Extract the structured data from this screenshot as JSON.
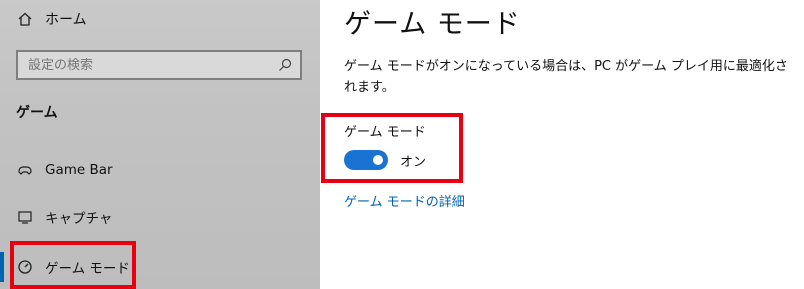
{
  "sidebar": {
    "home": {
      "label": "ホーム",
      "icon": "home-icon"
    },
    "search": {
      "placeholder": "設定の検索",
      "icon": "search-icon"
    },
    "section_title": "ゲーム",
    "items": [
      {
        "label": "Game Bar",
        "icon": "game-bar-icon",
        "selected": false
      },
      {
        "label": "キャプチャ",
        "icon": "capture-icon",
        "selected": false
      },
      {
        "label": "ゲーム モード",
        "icon": "game-mode-icon",
        "selected": true
      }
    ]
  },
  "main": {
    "title": "ゲーム モード",
    "description": "ゲーム モードがオンになっている場合は、PC がゲーム プレイ用に最適化されます。",
    "toggle": {
      "label": "ゲーム モード",
      "state_label": "オン",
      "on": true
    },
    "link": "ゲーム モードの詳細"
  },
  "colors": {
    "accent": "#0063b1",
    "toggle_on": "#1a73d2",
    "highlight_box": "#e60012",
    "sidebar_bg": "#c4c4c4"
  }
}
